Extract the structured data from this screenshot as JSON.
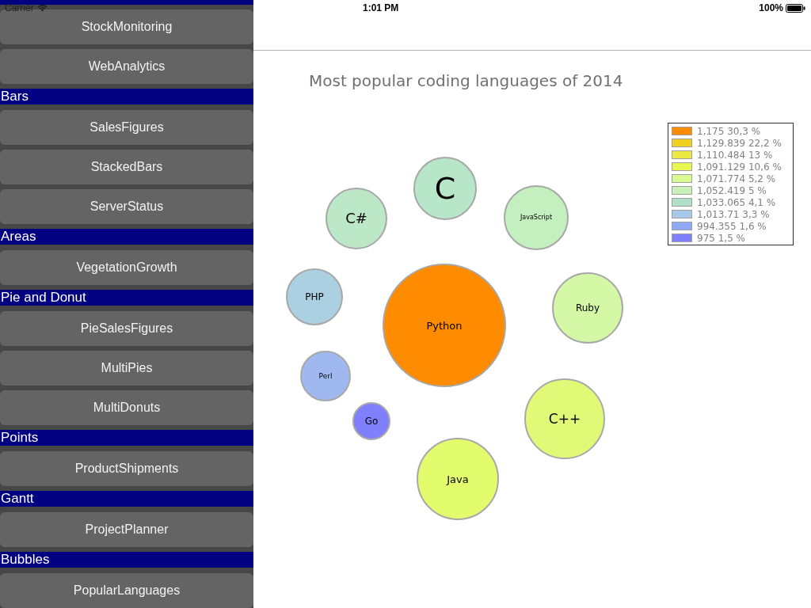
{
  "status_bar": {
    "carrier": "Carrier",
    "time": "1:01 PM",
    "battery": "100%"
  },
  "sidebar": {
    "sections": [
      {
        "items": [
          "StockMonitoring",
          "WebAnalytics"
        ]
      },
      {
        "title": "Bars",
        "items": [
          "SalesFigures",
          "StackedBars",
          "ServerStatus"
        ]
      },
      {
        "title": "Areas",
        "items": [
          "VegetationGrowth"
        ]
      },
      {
        "title": "Pie and Donut",
        "items": [
          "PieSalesFigures",
          "MultiPies",
          "MultiDonuts"
        ]
      },
      {
        "title": "Points",
        "items": [
          "ProductShipments"
        ]
      },
      {
        "title": "Gantt",
        "items": [
          "ProjectPlanner"
        ]
      },
      {
        "title": "Bubbles",
        "items": [
          "PopularLanguages"
        ]
      }
    ]
  },
  "chart": {
    "title": "Most popular coding languages of 2014",
    "bubbles": [
      {
        "label": "C",
        "color": "#b8e6c8"
      },
      {
        "label": "C#",
        "color": "#bde8c8"
      },
      {
        "label": "JavaScript",
        "color": "#c4f0c0"
      },
      {
        "label": "PHP",
        "color": "#aad0e2"
      },
      {
        "label": "Python",
        "color": "#ff8c00"
      },
      {
        "label": "Ruby",
        "color": "#d4f8a6"
      },
      {
        "label": "Perl",
        "color": "#a0b8f0"
      },
      {
        "label": "Go",
        "color": "#8080ff"
      },
      {
        "label": "C++",
        "color": "#e0fa78"
      },
      {
        "label": "Java",
        "color": "#e2fc6e"
      }
    ],
    "legend": [
      {
        "label": "1,175 30,3 %",
        "color": "#ff8c00"
      },
      {
        "label": "1,129.839 22,2 %",
        "color": "#f0d020"
      },
      {
        "label": "1,110.484 13 %",
        "color": "#eaea40"
      },
      {
        "label": "1,091.129 10,6 %",
        "color": "#e8f850"
      },
      {
        "label": "1,071.774 5,2 %",
        "color": "#d8fa90"
      },
      {
        "label": "1,052.419 5 %",
        "color": "#c8f0b8"
      },
      {
        "label": "1,033.065 4,1 %",
        "color": "#b0e0c8"
      },
      {
        "label": "1,013.71 3,3 %",
        "color": "#a8c8e8"
      },
      {
        "label": "994.355 1,6 %",
        "color": "#90a8f8"
      },
      {
        "label": "975 1,5 %",
        "color": "#8080ff"
      }
    ]
  }
}
